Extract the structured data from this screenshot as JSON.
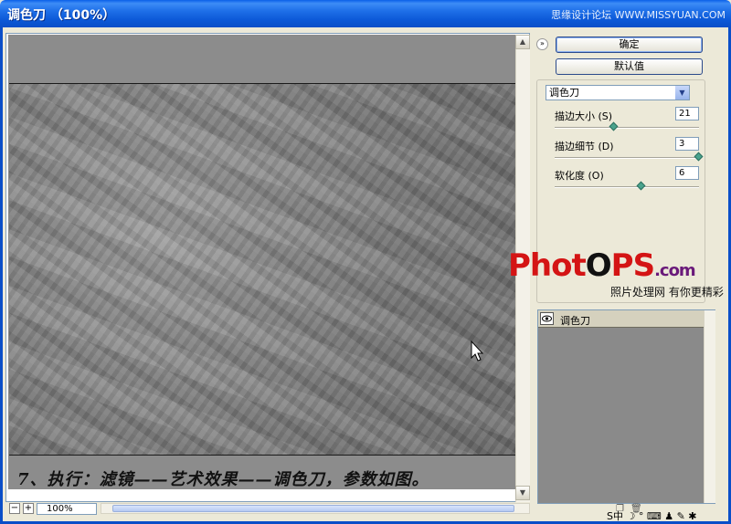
{
  "window": {
    "title": "调色刀 （100%）",
    "watermark": "思缘设计论坛 WWW.MISSYUAN.COM"
  },
  "buttons": {
    "ok": "确定",
    "default": "默认值"
  },
  "filter": {
    "selected": "调色刀"
  },
  "params": [
    {
      "label": "描边大小 (S)",
      "value": "21",
      "slider_fraction": 0.41
    },
    {
      "label": "描边细节 (D)",
      "value": "3",
      "slider_fraction": 1.0
    },
    {
      "label": "软化度 (O)",
      "value": "6",
      "slider_fraction": 0.6
    }
  ],
  "zoom": {
    "value": "100%",
    "minus": "−",
    "plus": "+"
  },
  "caption": "7、执行：滤镜——艺术效果——调色刀，参数如图。",
  "layers": {
    "items": [
      {
        "name": "调色刀"
      }
    ]
  },
  "logo": {
    "brand_pre": "Phot",
    "brand_o": "O",
    "brand_post": "PS",
    "brand_com": ".com",
    "slogan": "照片处理网 有你更精彩"
  },
  "tray": {
    "text": "S中 ☽ ° ⌨ ♟ ✎ ✱"
  },
  "colors": {
    "titlebar": "#0A5FE8",
    "window_bg": "#ECE9D8",
    "canvas": "#8C8C8C",
    "logo_red": "#D41414"
  }
}
